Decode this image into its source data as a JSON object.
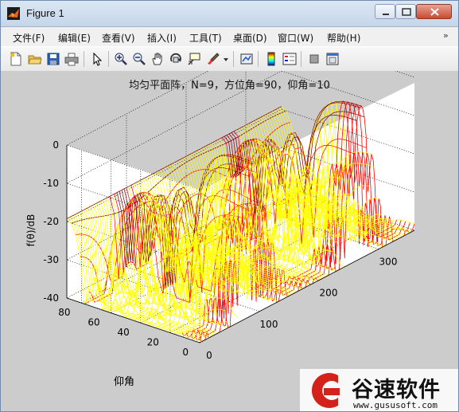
{
  "window": {
    "title": "Figure 1",
    "icon": "matlab-logo-icon",
    "buttons": [
      "minimize-icon",
      "maximize-icon",
      "close-icon"
    ]
  },
  "menu": {
    "items": [
      "文件(F)",
      "编辑(E)",
      "查看(V)",
      "插入(I)",
      "工具(T)",
      "桌面(D)",
      "窗口(W)",
      "帮助(H)"
    ],
    "overflow_icon": "chevron-icon"
  },
  "toolbar": {
    "icons": [
      "new-figure-icon",
      "open-file-icon",
      "save-icon",
      "print-icon",
      "edit-plot-icon",
      "zoom-in-icon",
      "zoom-out-icon",
      "pan-icon",
      "rotate-3d-icon",
      "data-cursor-icon",
      "brush-icon",
      "link-plot-icon",
      "insert-colorbar-icon",
      "insert-legend-icon",
      "hide-plot-tools-icon",
      "show-plot-tools-icon"
    ]
  },
  "figure": {
    "title": "均匀平面阵，N=9，方位角=90，仰角=10",
    "background": "#cccccc",
    "colormap": [
      "#000080",
      "#0000ff",
      "#00ffff",
      "#80ff80",
      "#ffff00",
      "#ff0000",
      "#800000"
    ]
  },
  "chart_data": {
    "type": "surface",
    "title": "均匀平面阵，N=9，方位角=90，仰角=10",
    "zlabel": "f(θ)/dB",
    "ylabel": "仰角",
    "xlabel": "",
    "zticks": [
      "0",
      "-10",
      "-20",
      "-30",
      "-40"
    ],
    "yticks": [
      "80",
      "60",
      "40",
      "20",
      "0"
    ],
    "xticks": [
      "0",
      "100",
      "200",
      "300"
    ],
    "zlim": [
      -40,
      0
    ],
    "ylim": [
      0,
      90
    ],
    "xlim": [
      0,
      360
    ],
    "grid": true,
    "main_beam": {
      "azimuth": 90,
      "elevation": 10,
      "level_db": 0
    },
    "view": "3d"
  },
  "watermark": {
    "text": "谷速软件",
    "url": "www.gususoft.com"
  }
}
